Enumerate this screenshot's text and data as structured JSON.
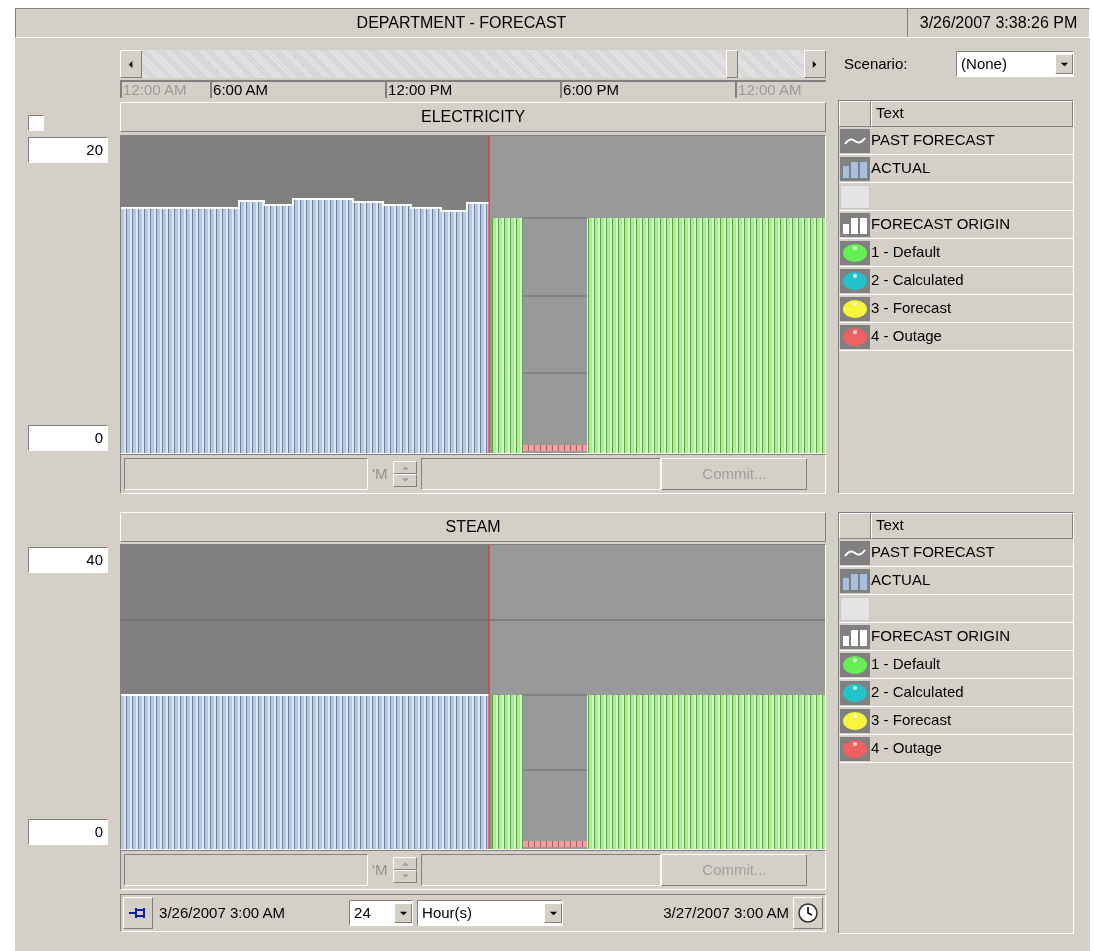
{
  "window": {
    "title": "DEPARTMENT - FORECAST",
    "timestamp": "3/26/2007 3:38:26 PM"
  },
  "timeline": {
    "labels": [
      {
        "text": "12:00 AM",
        "disabled": true
      },
      {
        "text": "6:00 AM",
        "disabled": false
      },
      {
        "text": "12:00 PM",
        "disabled": false
      },
      {
        "text": "6:00 PM",
        "disabled": false
      },
      {
        "text": "12:00 AM",
        "disabled": true
      }
    ]
  },
  "scenario": {
    "label": "Scenario:",
    "value": "(None)"
  },
  "panels": [
    {
      "title": "ELECTRICITY",
      "checkbox": {
        "checked": false
      },
      "max": "20",
      "min": "0",
      "spin_value": "'M",
      "commit": {
        "label": "Commit...",
        "disabled": true
      },
      "legend": {
        "header": "Text",
        "items": [
          {
            "kind": "line",
            "label": "PAST FORECAST"
          },
          {
            "kind": "bars",
            "label": "ACTUAL"
          },
          {
            "kind": "blank"
          },
          {
            "kind": "origin",
            "label": "FORECAST ORIGIN"
          },
          {
            "kind": "dot",
            "label": "1 - Default",
            "color": "#66ee55"
          },
          {
            "kind": "dot",
            "label": "2 - Calculated",
            "color": "#22c4cc"
          },
          {
            "kind": "dot",
            "label": "3 - Forecast",
            "color": "#f5f53a"
          },
          {
            "kind": "dot",
            "label": "4 - Outage",
            "color": "#f06060"
          }
        ]
      }
    },
    {
      "title": "STEAM",
      "max": "40",
      "min": "0",
      "spin_value": "'M",
      "commit": {
        "label": "Commit...",
        "disabled": true
      },
      "legend": {
        "header": "Text",
        "items": [
          {
            "kind": "line",
            "label": "PAST FORECAST"
          },
          {
            "kind": "bars",
            "label": "ACTUAL"
          },
          {
            "kind": "blank"
          },
          {
            "kind": "origin",
            "label": "FORECAST ORIGIN"
          },
          {
            "kind": "dot",
            "label": "1 - Default",
            "color": "#66ee55"
          },
          {
            "kind": "dot",
            "label": "2 - Calculated",
            "color": "#22c4cc"
          },
          {
            "kind": "dot",
            "label": "3 - Forecast",
            "color": "#f5f53a"
          },
          {
            "kind": "dot",
            "label": "4 - Outage",
            "color": "#f06060"
          }
        ]
      }
    }
  ],
  "footer": {
    "start": "3/26/2007 3:00 AM",
    "count": "24",
    "unit": "Hour(s)",
    "end": "3/27/2007 3:00 AM"
  }
}
